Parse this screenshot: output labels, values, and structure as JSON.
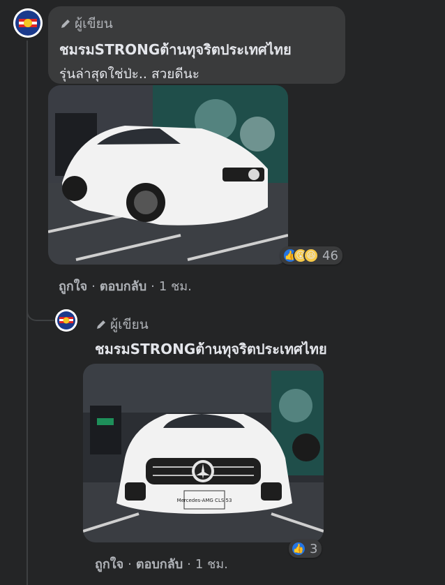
{
  "comment": {
    "author_badge": "ผู้เขียน",
    "author_name": "ชมรมSTRONGต้านทุจริตประเทศไทย",
    "text": "รุ่นล่าสุดใช่ป่ะ.. สวยดีนะ",
    "avatar_text": "STRONG",
    "reactions": {
      "icons": [
        "like-icon",
        "wow-icon",
        "haha-icon"
      ],
      "count": "46"
    },
    "actions": {
      "like": "ถูกใจ",
      "reply": "ตอบกลับ",
      "time": "1 ชม."
    }
  },
  "reply": {
    "author_badge": "ผู้เขียน",
    "author_name": "ชมรมSTRONGต้านทุจริตประเทศไทย",
    "reactions": {
      "icons": [
        "like-icon"
      ],
      "count": "3"
    },
    "actions": {
      "like": "ถูกใจ",
      "reply": "ตอบกลับ",
      "time": "1 ชม."
    },
    "plate_text": "Mercedes-AMG CLS 53"
  },
  "colors": {
    "background": "#242526",
    "bubble": "#3a3b3c",
    "secondary_text": "#b0b3b8",
    "like_blue": "#2374e1"
  }
}
